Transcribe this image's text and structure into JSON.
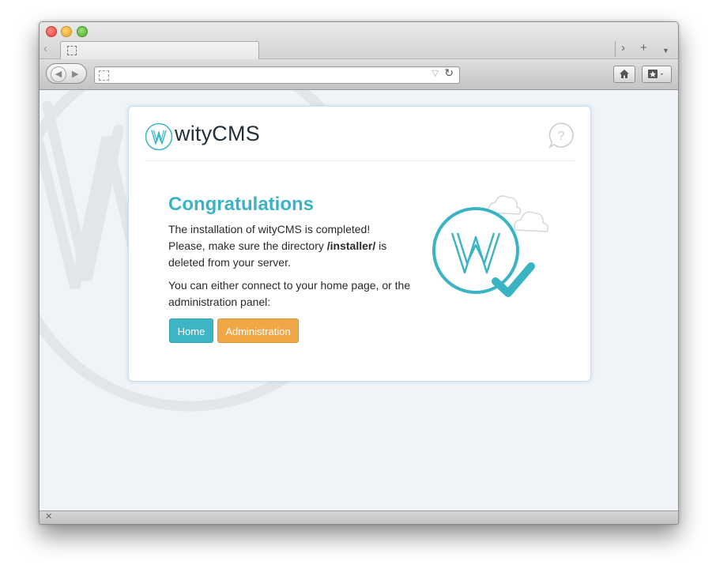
{
  "browser": {
    "tab_title": "",
    "url": ""
  },
  "page": {
    "logo_text": "wityCMS",
    "title": "Congratulations",
    "message_line1": "The installation of wityCMS is completed!",
    "message_line2_prefix": "Please, make sure the directory ",
    "message_line2_dir": "/installer/",
    "message_line2_suffix": " is deleted from your server.",
    "message_connect": "You can either connect to your home page, or the administration panel:",
    "buttons": {
      "home_label": "Home",
      "admin_label": "Administration"
    }
  },
  "colors": {
    "accent": "#3ab4c3",
    "home_button": "#3eb5c5",
    "admin_button": "#f0a847"
  },
  "icons": [
    "back-icon",
    "forward-icon",
    "new-tab-icon",
    "tab-menu-icon",
    "reload-icon",
    "home-icon",
    "bookmarks-icon",
    "help-icon",
    "checkmark-icon",
    "cloud-icon",
    "close-icon"
  ]
}
